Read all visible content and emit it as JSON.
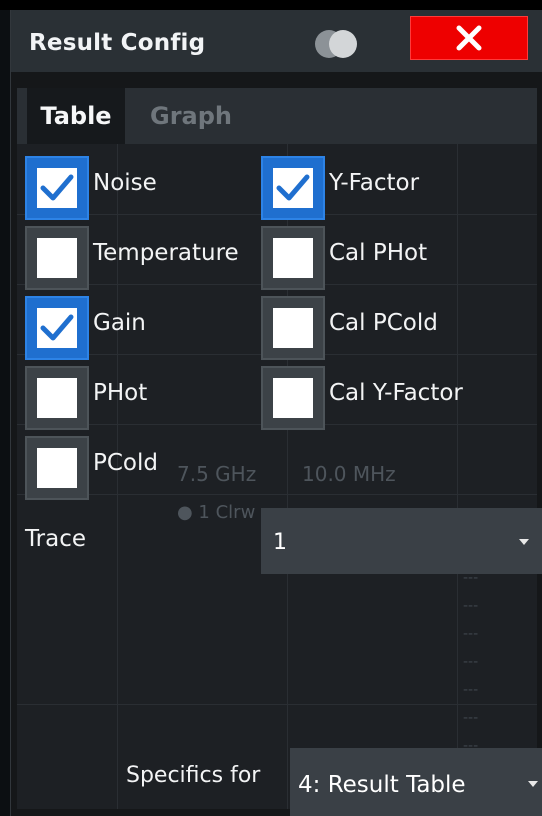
{
  "dialog": {
    "title": "Result Config",
    "close_label": "×"
  },
  "tabs": [
    {
      "label": "Table",
      "active": true
    },
    {
      "label": "Graph",
      "active": false
    }
  ],
  "checkboxes": {
    "left": [
      {
        "label": "Noise",
        "checked": true
      },
      {
        "label": "Temperature",
        "checked": false
      },
      {
        "label": "Gain",
        "checked": true
      },
      {
        "label": "PHot",
        "checked": false
      },
      {
        "label": "PCold",
        "checked": false
      }
    ],
    "right": [
      {
        "label": "Y-Factor",
        "checked": true
      },
      {
        "label": "Cal PHot",
        "checked": false
      },
      {
        "label": "Cal PCold",
        "checked": false
      },
      {
        "label": "Cal Y-Factor",
        "checked": false
      }
    ]
  },
  "trace": {
    "label": "Trace",
    "value": "1"
  },
  "specifics": {
    "label": "Specifics for",
    "value": "4: Result Table"
  },
  "background_text": {
    "freq": "7.5 GHz",
    "span": "10.0 MHz",
    "trace_tag": "● 1 Clrw",
    "dashes": [
      "---",
      "---",
      "---",
      "---",
      "---",
      "---",
      "---"
    ]
  },
  "colors": {
    "accent": "#1f6fcf",
    "close": "#ee0000",
    "panel": "#1b1e22"
  }
}
